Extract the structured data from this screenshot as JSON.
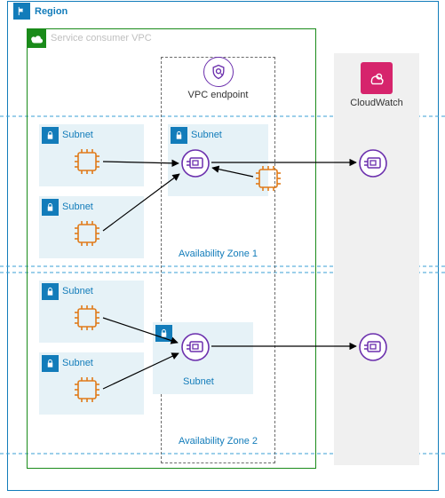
{
  "region": {
    "label": "Region"
  },
  "vpc": {
    "label": "Service consumer VPC"
  },
  "endpoint": {
    "label": "VPC endpoint"
  },
  "cloudwatch": {
    "label": "CloudWatch"
  },
  "subnets": {
    "s1": "Subnet",
    "s2": "Subnet",
    "s3": "Subnet",
    "s4": "Subnet",
    "s5": "Subnet",
    "s6": "Subnet"
  },
  "az": {
    "a1": "Availability Zone 1",
    "a2": "Availability Zone 2"
  },
  "colors": {
    "region": "#127cba",
    "vpc": "#1a8b1a",
    "endpoint": "#6b2fad",
    "subnetBg": "#e6f2f7",
    "cpu": "#e07b1a",
    "cloudwatch": "#d6246c",
    "dash": "#3a9fd6"
  }
}
